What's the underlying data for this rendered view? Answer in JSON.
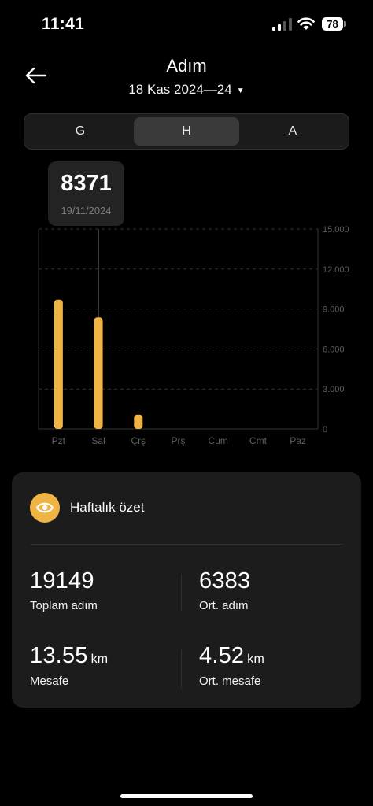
{
  "status_bar": {
    "time": "11:41",
    "battery": "78"
  },
  "header": {
    "title": "Adım",
    "date_range": "18 Kas 2024—24"
  },
  "segments": [
    {
      "label": "G",
      "active": false
    },
    {
      "label": "H",
      "active": true
    },
    {
      "label": "A",
      "active": false
    }
  ],
  "tooltip": {
    "value": "8371",
    "date": "19/11/2024"
  },
  "chart_data": {
    "type": "bar",
    "categories": [
      "Pzt",
      "Sal",
      "Çrş",
      "Prş",
      "Cum",
      "Cmt",
      "Paz"
    ],
    "values": [
      9700,
      8371,
      1078,
      0,
      0,
      0,
      0
    ],
    "y_ticks": [
      "0",
      "3.000",
      "6.000",
      "9.000",
      "12.000",
      "15.000"
    ],
    "ylim": [
      0,
      15000
    ],
    "selected_index": 1,
    "bar_color": "#f0b445",
    "grid": true
  },
  "summary": {
    "title": "Haftalık özet",
    "stats": [
      {
        "value": "19149",
        "unit": "",
        "label": "Toplam adım"
      },
      {
        "value": "6383",
        "unit": "",
        "label": "Ort. adım"
      },
      {
        "value": "13.55",
        "unit": "km",
        "label": "Mesafe"
      },
      {
        "value": "4.52",
        "unit": "km",
        "label": "Ort. mesafe"
      }
    ]
  },
  "colors": {
    "accent": "#f0b445",
    "background": "#000000",
    "card": "#1c1c1c"
  }
}
